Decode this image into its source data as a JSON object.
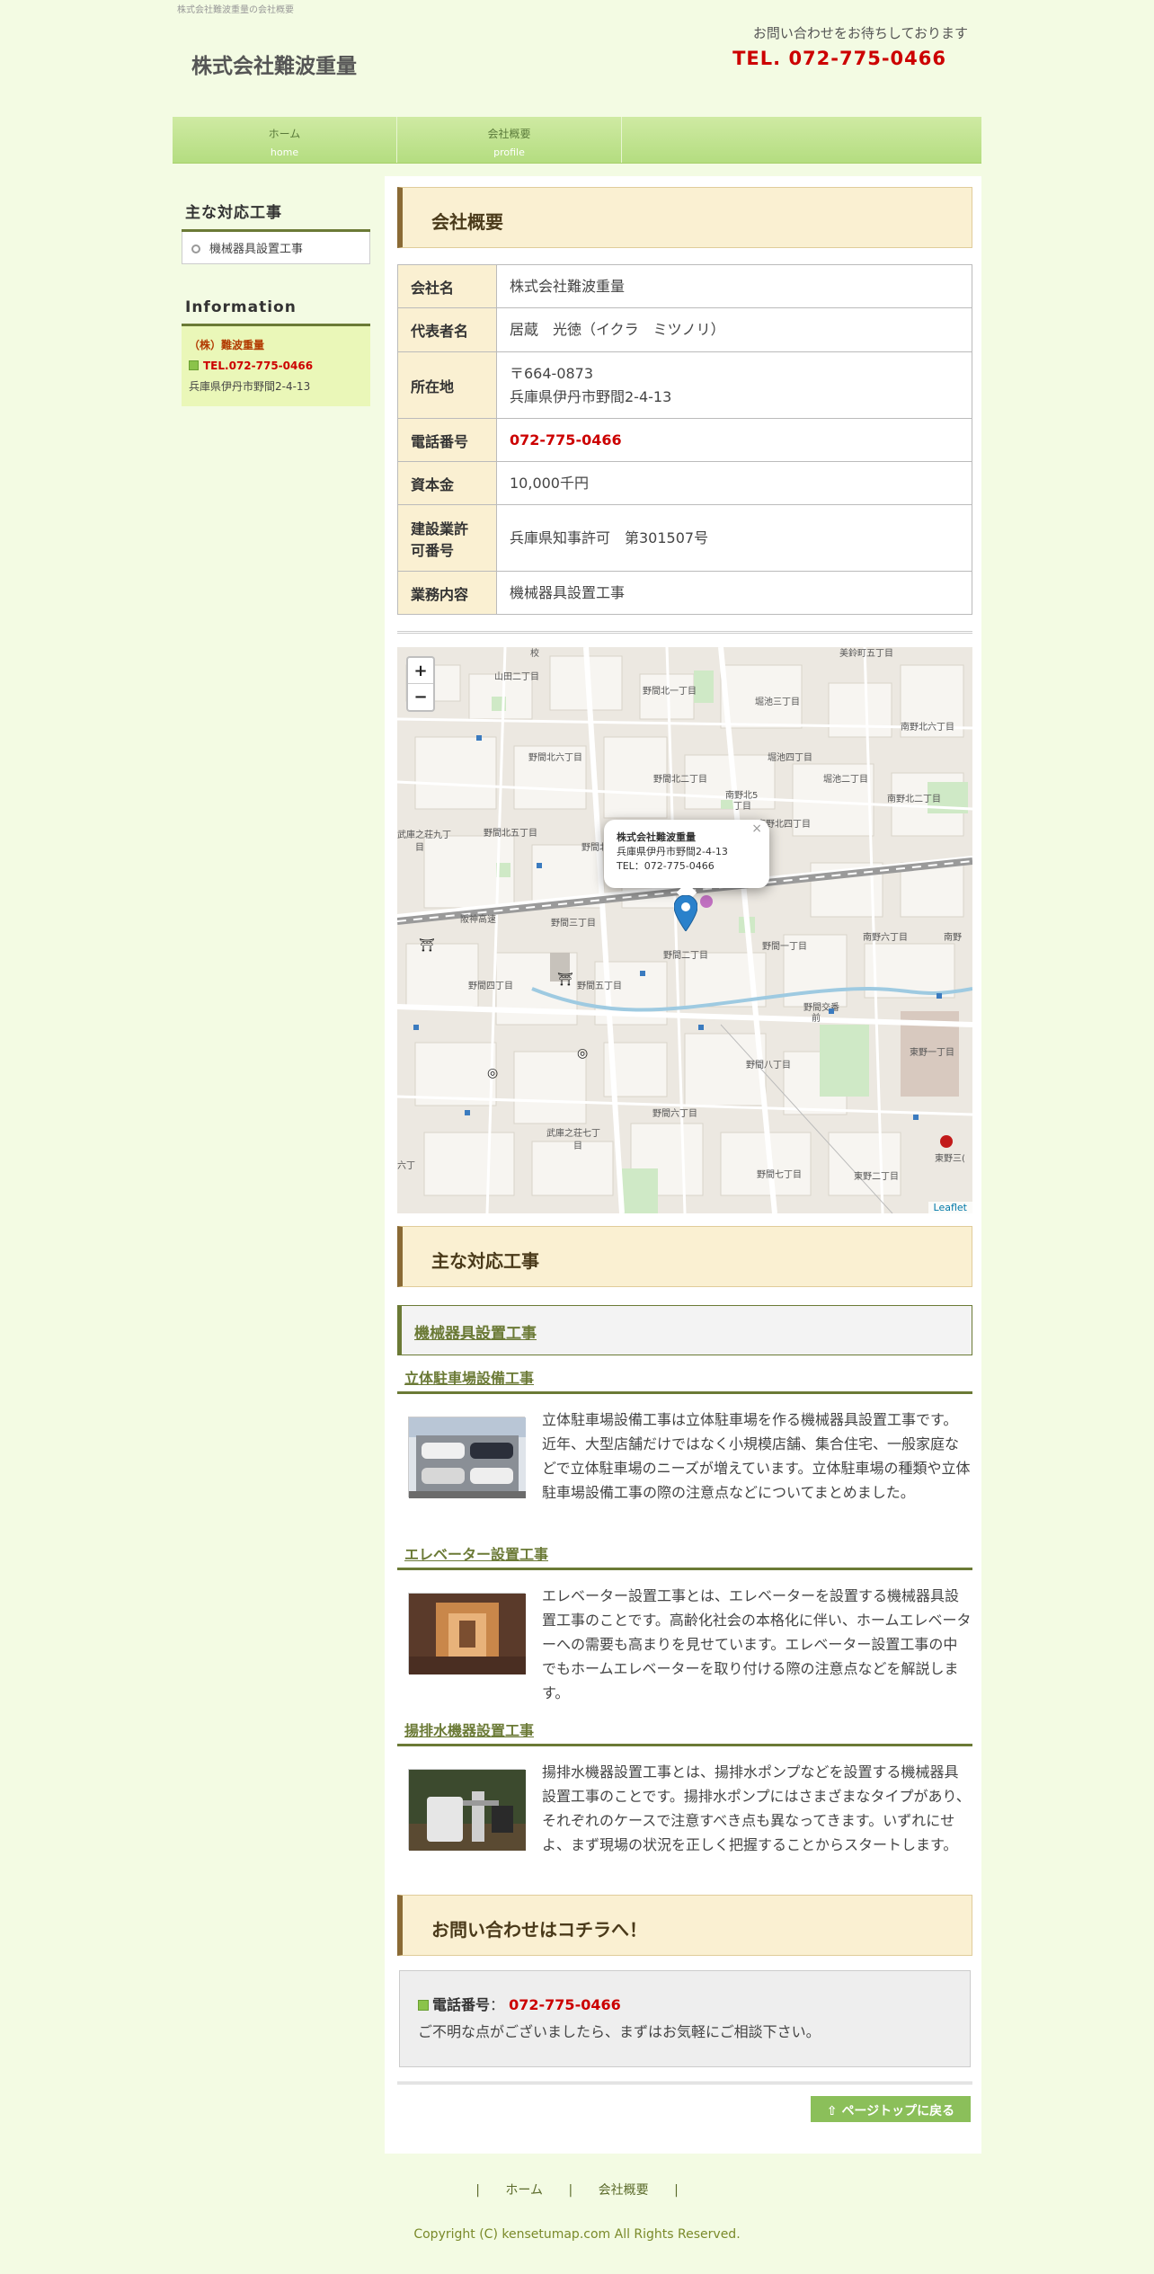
{
  "header": {
    "topline": "株式会社難波重量の会社概要",
    "logo": "株式会社難波重量",
    "contact_msg": "お問い合わせをお待ちしております",
    "contact_tel": "TEL. 072-775-0466"
  },
  "gnav": [
    {
      "jp": "ホーム",
      "en": "home"
    },
    {
      "jp": "会社概要",
      "en": "profile"
    }
  ],
  "sidebar": {
    "works_title": "主な対応工事",
    "works_item": "機械器具設置工事",
    "info_title": "Information",
    "info_company": "（株）難波重量",
    "info_tel": "TEL.072-775-0466",
    "info_address": "兵庫県伊丹市野間2-4-13"
  },
  "profile": {
    "title": "会社概要",
    "rows": [
      {
        "label": "会社名",
        "value": "株式会社難波重量"
      },
      {
        "label": "代表者名",
        "value": "居蔵　光徳（イクラ　ミツノリ）"
      },
      {
        "label": "所在地",
        "value": "〒664-0873",
        "value2": "兵庫県伊丹市野間2-4-13"
      },
      {
        "label": "電話番号",
        "value": "072-775-0466"
      },
      {
        "label": "資本金",
        "value": "10,000千円"
      },
      {
        "label": "建設業許",
        "label2": "可番号",
        "value": "兵庫県知事許可　第301507号"
      },
      {
        "label": "業務内容",
        "value": "機械器具設置工事"
      }
    ]
  },
  "map": {
    "zoom_in": "+",
    "zoom_out": "−",
    "popup_title": "株式会社難波重量",
    "popup_address": "兵庫県伊丹市野間2-4-13",
    "popup_tel": "TEL：072-775-0466",
    "popup_close": "×",
    "attribution": "Leaflet",
    "labels": [
      "山田二丁目",
      "野間北一丁目",
      "堀池三丁目",
      "美鈴町五丁目",
      "南野北六丁目",
      "堀池四丁目",
      "野間北六丁目",
      "野間北二丁目",
      "堀池二丁目",
      "南野北5丁目",
      "野間北五丁目",
      "南野北二丁目",
      "野間北四",
      "南野北四丁目",
      "野間三丁目",
      "野間二丁目",
      "野間一丁目",
      "南野六丁目",
      "野間四丁目",
      "野間五丁目",
      "野間八丁目",
      "東野一丁目",
      "武庫之荘七丁目",
      "野間六丁目",
      "野間七丁目",
      "東野二丁目",
      "六丁",
      "武庫之荘九丁目",
      "野間交番前",
      "東野三丁目",
      "校",
      "阪神高速"
    ]
  },
  "works": {
    "title": "主な対応工事",
    "category": "機械器具設置工事",
    "items": [
      {
        "title": "立体駐車場設備工事",
        "text": "立体駐車場設備工事は立体駐車場を作る機械器具設置工事です。近年、大型店舗だけではなく小規模店舗、集合住宅、一般家庭などで立体駐車場のニーズが増えています。立体駐車場の種類や立体駐車場設備工事の際の注意点などについてまとめました。"
      },
      {
        "title": "エレベーター設置工事",
        "text": "エレベーター設置工事とは、エレベーターを設置する機械器具設置工事のことです。高齢化社会の本格化に伴い、ホームエレベーターへの需要も高まりを見せています。エレベーター設置工事の中でもホームエレベーターを取り付ける際の注意点などを解説します。"
      },
      {
        "title": "揚排水機器設置工事",
        "text": "揚排水機器設置工事とは、揚排水ポンプなどを設置する機械器具設置工事のことです。揚排水ポンプにはさまざまなタイプがあり、それぞれのケースで注意すべき点も異なってきます。いずれにせよ、まず現場の状況を正しく把握することからスタートします。"
      }
    ]
  },
  "inquiry": {
    "title": "お問い合わせはコチラへ！",
    "tel_label": "電話番号",
    "colon": "：",
    "tel": "072-775-0466",
    "note": "ご不明な点がございましたら、まずはお気軽にご相談下さい。"
  },
  "pagetop": "ページトップに戻る",
  "footer": {
    "sep": "|",
    "nav": [
      "ホーム",
      "会社概要"
    ],
    "copyright": "Copyright (C) kensetumap.com All Rights Reserved."
  },
  "colors": {
    "accent_red": "#cc0000",
    "brand_green": "#6b7a36",
    "nav_green": "#b4dd80"
  }
}
